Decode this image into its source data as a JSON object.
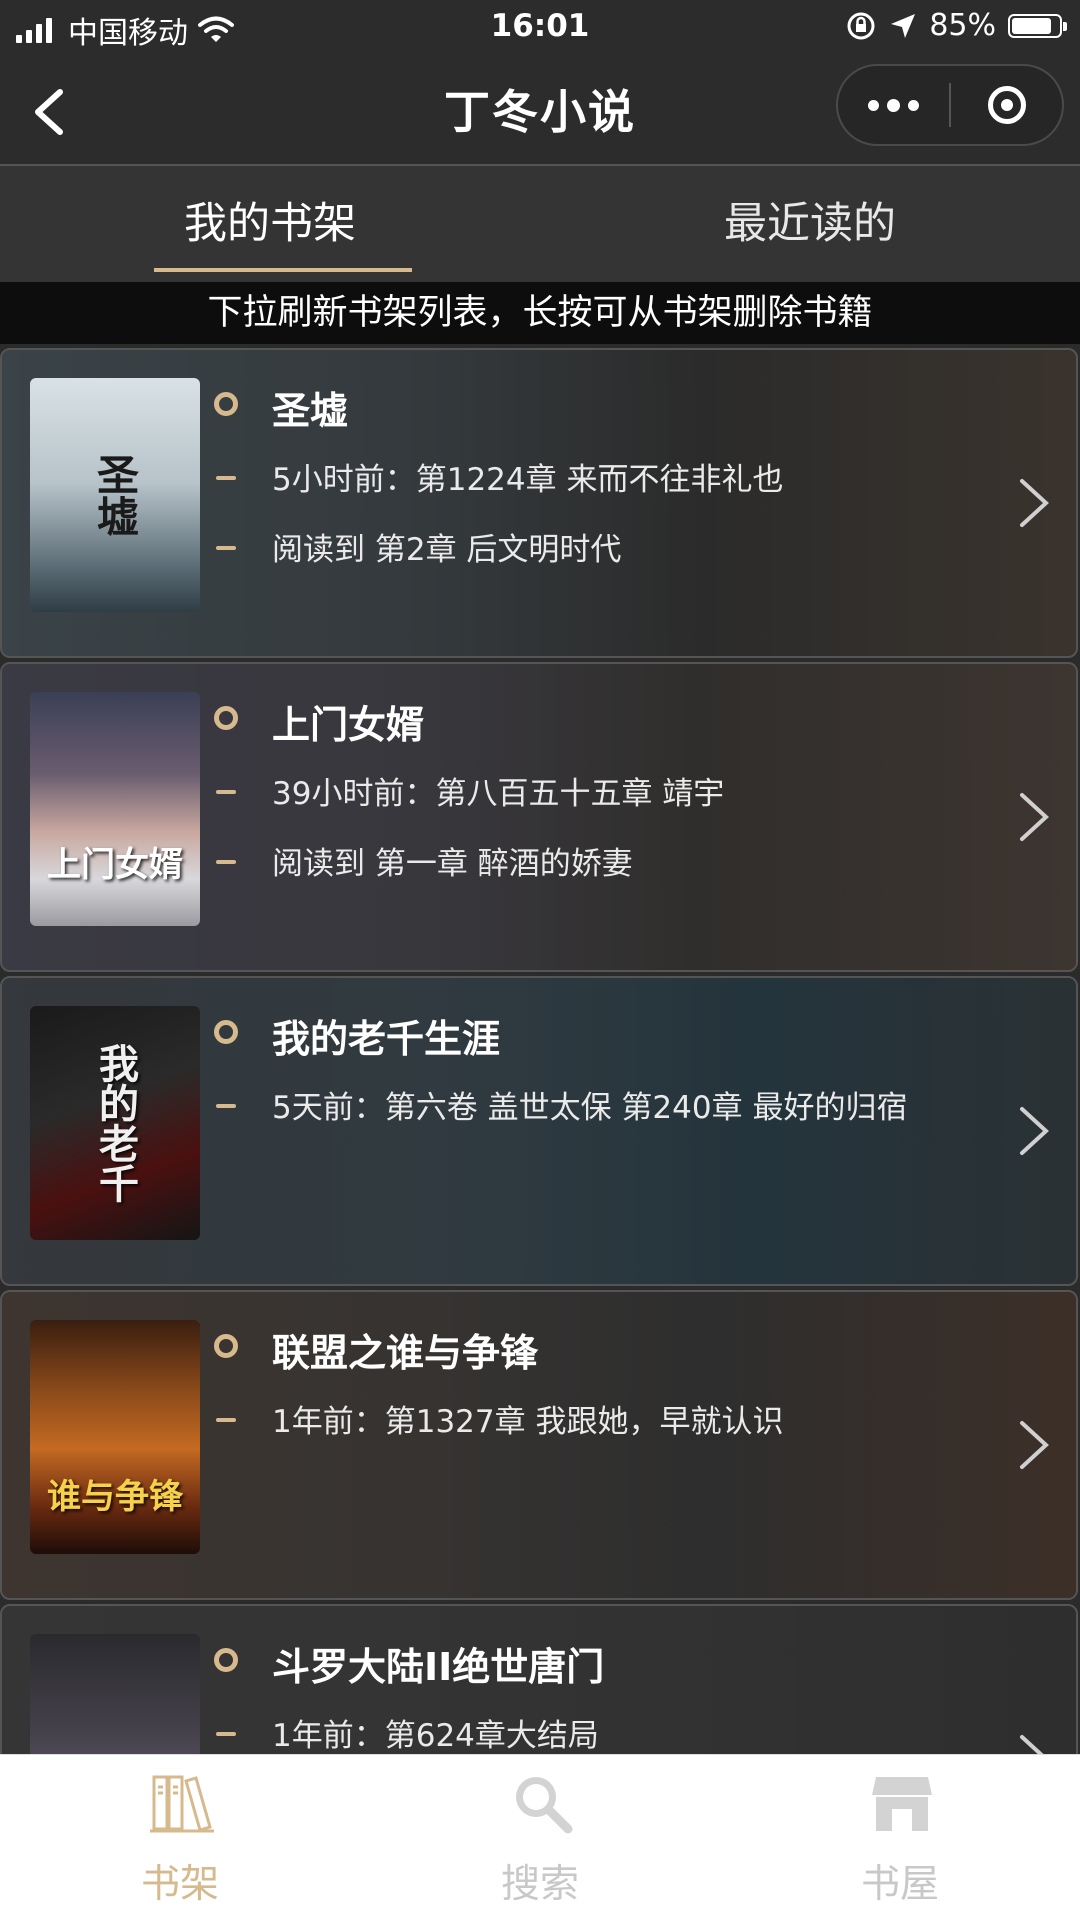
{
  "status_bar": {
    "carrier": "中国移动",
    "time": "16:01",
    "battery_percent_label": "85%",
    "battery_level": 0.85
  },
  "nav": {
    "title": "丁冬小说"
  },
  "tabs": [
    {
      "label": "我的书架",
      "active": true
    },
    {
      "label": "最近读的",
      "active": false
    }
  ],
  "hint": "下拉刷新书架列表，长按可从书架删除书籍",
  "books": [
    {
      "title": "圣墟",
      "cover_text": "圣墟",
      "latest": "5小时前：第1224章 来而不往非礼也",
      "progress": "阅读到 第2章 后文明时代"
    },
    {
      "title": "上门女婿",
      "cover_text": "上门女婿",
      "latest": "39小时前：第八百五十五章 靖宇",
      "progress": "阅读到 第一章 醉酒的娇妻"
    },
    {
      "title": "我的老千生涯",
      "cover_text": "我的老千",
      "latest": "5天前：第六卷 盖世太保 第240章 最好的归宿",
      "progress": ""
    },
    {
      "title": "联盟之谁与争锋",
      "cover_text": "谁与争锋",
      "latest": "1年前：第1327章 我跟她，早就认识",
      "progress": ""
    },
    {
      "title": "斗罗大陆II绝世唐门",
      "cover_text": "",
      "latest": "1年前：第624章大结局",
      "progress": ""
    }
  ],
  "tabbar": [
    {
      "label": "书架",
      "icon": "bookshelf-icon",
      "active": true
    },
    {
      "label": "搜索",
      "icon": "search-icon",
      "active": false
    },
    {
      "label": "书屋",
      "icon": "store-icon",
      "active": false
    }
  ],
  "colors": {
    "accent": "#d7b98e",
    "background": "#2b2b2b"
  }
}
